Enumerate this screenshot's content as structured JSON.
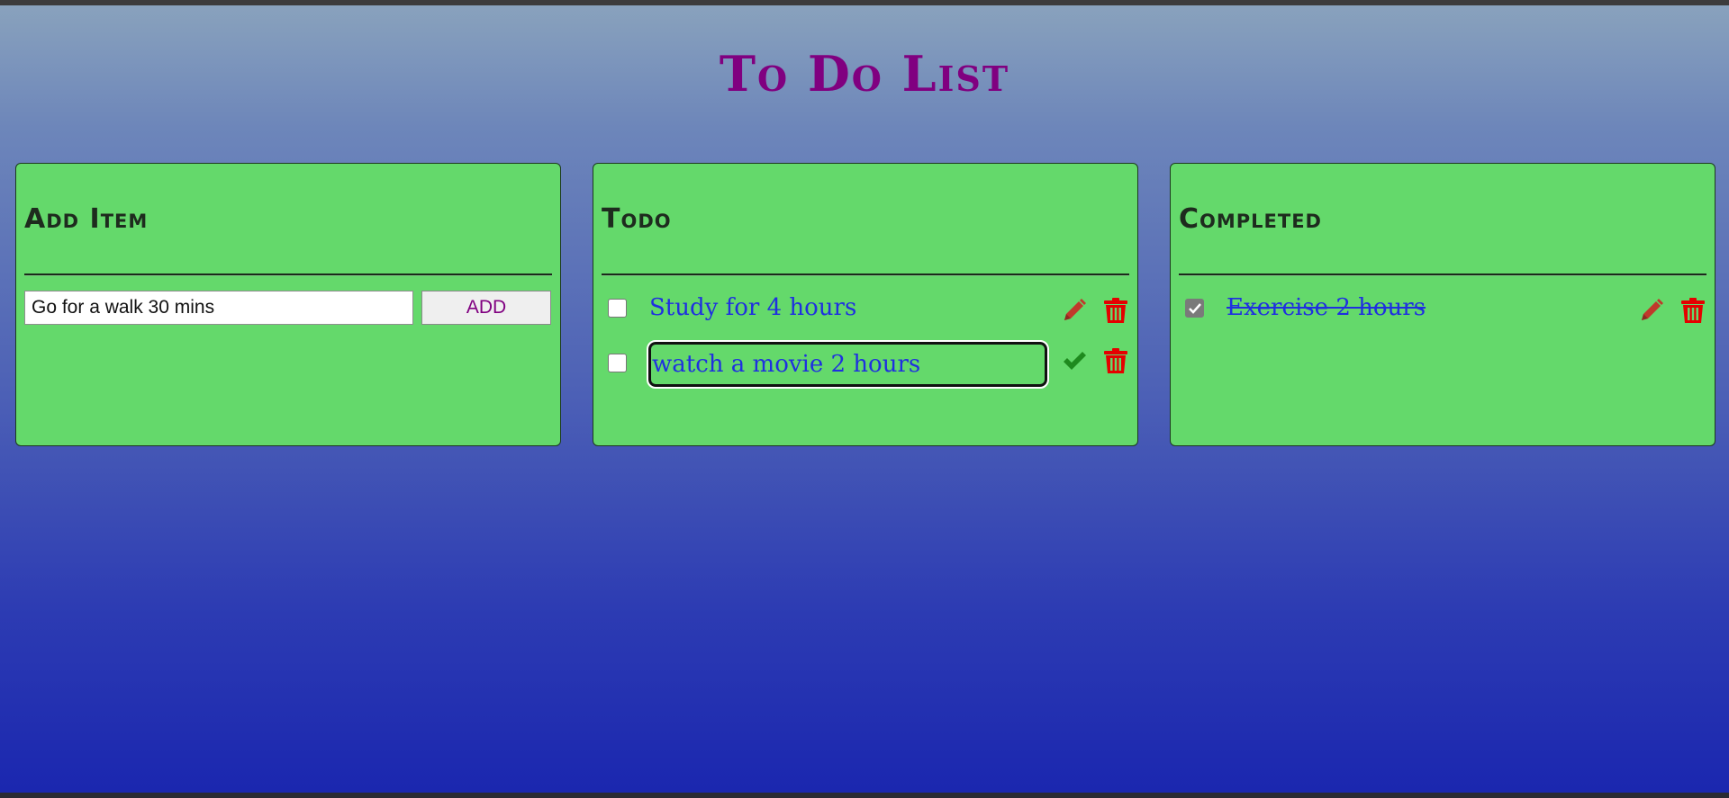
{
  "page": {
    "title": "To Do List"
  },
  "add_panel": {
    "heading": "Add Item",
    "input_value": "Go for a walk 30 mins",
    "button_label": "ADD"
  },
  "todo_panel": {
    "heading": "Todo",
    "items": [
      {
        "text": "Study for 4 hours",
        "checked": false,
        "editing": false
      },
      {
        "text": "watch a movie 2 hours",
        "checked": false,
        "editing": true
      }
    ]
  },
  "completed_panel": {
    "heading": "Completed",
    "items": [
      {
        "text": "Exercise 2 hours",
        "checked": true,
        "editing": false
      }
    ]
  },
  "icons": {
    "edit": "pencil-icon",
    "delete": "trash-icon",
    "save": "check-icon"
  },
  "colors": {
    "title": "#800080",
    "panel_bg": "#64d96b",
    "item_text": "#1f2fe0",
    "edit_icon": "#c0392b",
    "delete_icon": "#e50000",
    "save_icon": "#1e8a1e",
    "add_button_text": "#800080"
  }
}
